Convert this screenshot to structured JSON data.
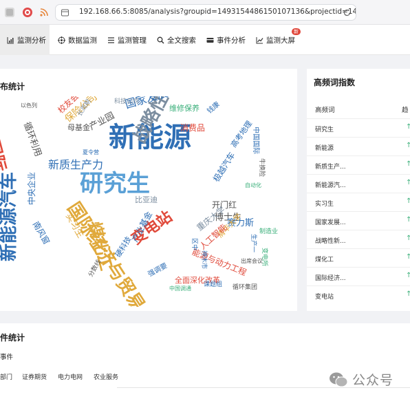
{
  "browser": {
    "url": "192.168.66.5:8085/analysis?groupid=1493154486150107136&projectid=14931546451..."
  },
  "nav": {
    "items": [
      {
        "label": "监测分析",
        "icon": "bar-chart-icon"
      },
      {
        "label": "数据监测",
        "icon": "target-icon"
      },
      {
        "label": "监测管理",
        "icon": "list-icon"
      },
      {
        "label": "全文搜索",
        "icon": "search-icon"
      },
      {
        "label": "事件分析",
        "icon": "card-icon"
      },
      {
        "label": "监测大屏",
        "icon": "line-chart-icon",
        "badge": "新"
      }
    ]
  },
  "wordcloud": {
    "title": "布统计",
    "words": [
      {
        "t": "新能源",
        "c": "#2f6fb5",
        "s": 40
      },
      {
        "t": "研究生",
        "c": "#5aa0d6",
        "s": 34
      },
      {
        "t": "国际经济与贸易",
        "c": "#e0a93b",
        "s": 26
      },
      {
        "t": "战略性新兴产业",
        "c": "#7c8ea0",
        "s": 26
      },
      {
        "t": "新能源汽车",
        "c": "#2f6fb5",
        "s": 26
      },
      {
        "t": "煤化工",
        "c": "#e0a93b",
        "s": 24
      },
      {
        "t": "变电站",
        "c": "#e04a3b",
        "s": 22
      },
      {
        "t": "国家发展改革委",
        "c": "#2f6fb5",
        "s": 16
      },
      {
        "t": "新质生产力",
        "c": "#2f6fb5",
        "s": 16
      },
      {
        "t": "国际",
        "c": "#e04a3b",
        "s": 24
      },
      {
        "t": "保险公司",
        "c": "#e0a93b",
        "s": 14
      },
      {
        "t": "产业园",
        "c": "#555555",
        "s": 13
      },
      {
        "t": "循环利用",
        "c": "#555555",
        "s": 13
      },
      {
        "t": "校友会",
        "c": "#e04a3b",
        "s": 12
      },
      {
        "t": "长周期",
        "c": "#7c8ea0",
        "s": 9
      },
      {
        "t": "母基金",
        "c": "#555555",
        "s": 11
      },
      {
        "t": "维修保养",
        "c": "#3aaf7a",
        "s": 11
      },
      {
        "t": "消费品",
        "c": "#e04a3b",
        "s": 12
      },
      {
        "t": "高考地理",
        "c": "#2f6fb5",
        "s": 11
      },
      {
        "t": "极越汽车",
        "c": "#2f6fb5",
        "s": 12
      },
      {
        "t": "中国国际",
        "c": "#2f6fb5",
        "s": 10
      },
      {
        "t": "博士生",
        "c": "#555555",
        "s": 13
      },
      {
        "t": "开门红",
        "c": "#555555",
        "s": 12
      },
      {
        "t": "赛力斯",
        "c": "#2f6fb5",
        "s": 13
      },
      {
        "t": "重庆大学",
        "c": "#7c8ea0",
        "s": 12
      },
      {
        "t": "清华大学",
        "c": "#e0a93b",
        "s": 11
      },
      {
        "t": "能源与动力工程",
        "c": "#e04a3b",
        "s": 12
      },
      {
        "t": "人工智能",
        "c": "#e04a3b",
        "s": 12
      },
      {
        "t": "全面深化改革",
        "c": "#e04a3b",
        "s": 11
      },
      {
        "t": "强调要",
        "c": "#2f6fb5",
        "s": 10
      },
      {
        "t": "硬科技",
        "c": "#2f6fb5",
        "s": 11
      },
      {
        "t": "实习生",
        "c": "#e0a93b",
        "s": 13
      },
      {
        "t": "中央企业",
        "c": "#2f6fb5",
        "s": 12
      },
      {
        "t": "南风窗",
        "c": "#2f6fb5",
        "s": 12
      },
      {
        "t": "产业基金",
        "c": "#2f6fb5",
        "s": 12
      },
      {
        "t": "比亚迪",
        "c": "#7c8ea0",
        "s": 11
      },
      {
        "t": "循环集团",
        "c": "#555555",
        "s": 9
      },
      {
        "t": "课题组",
        "c": "#2f6fb5",
        "s": 9
      },
      {
        "t": "中国调通",
        "c": "#3aaf7a",
        "s": 8
      },
      {
        "t": "分数线",
        "c": "#555555",
        "s": 9
      },
      {
        "t": "出席会议",
        "c": "#555555",
        "s": 8
      },
      {
        "t": "钱康",
        "c": "#2f6fb5",
        "s": 10
      },
      {
        "t": "科技公司",
        "c": "#7c8ea0",
        "s": 9
      },
      {
        "t": "以色列",
        "c": "#555555",
        "s": 8
      },
      {
        "t": "夏令营",
        "c": "#2f6fb5",
        "s": 8
      },
      {
        "t": "自动化",
        "c": "#3aaf7a",
        "s": 8
      },
      {
        "t": "牛换险",
        "c": "#555555",
        "s": 9
      },
      {
        "t": "神木市",
        "c": "#2f6fb5",
        "s": 9
      },
      {
        "t": "区中",
        "c": "#2f6fb5",
        "s": 9
      },
      {
        "t": "生产一",
        "c": "#2f6fb5",
        "s": 9
      },
      {
        "t": "变电所",
        "c": "#3aaf7a",
        "s": 9
      },
      {
        "t": "制造业",
        "c": "#3aaf7a",
        "s": 9
      }
    ]
  },
  "freq": {
    "title": "高频词指数",
    "col_word": "高频词",
    "col_trend": "趋",
    "rows": [
      "研究生",
      "新能源",
      "新质生产...",
      "新能源汽...",
      "实习生",
      "国家发展...",
      "战略性新...",
      "煤化工",
      "国际经济...",
      "变电站"
    ]
  },
  "events": {
    "title": "件统计",
    "subtitle": "事件",
    "tabs": [
      "部门",
      "证券期货",
      "电力电网",
      "农业服务"
    ]
  },
  "watermark": {
    "text": "公众号"
  },
  "colors": {
    "accent": "#2f6fb5",
    "up": "#3aaf7a",
    "badge": "#e0473b"
  }
}
